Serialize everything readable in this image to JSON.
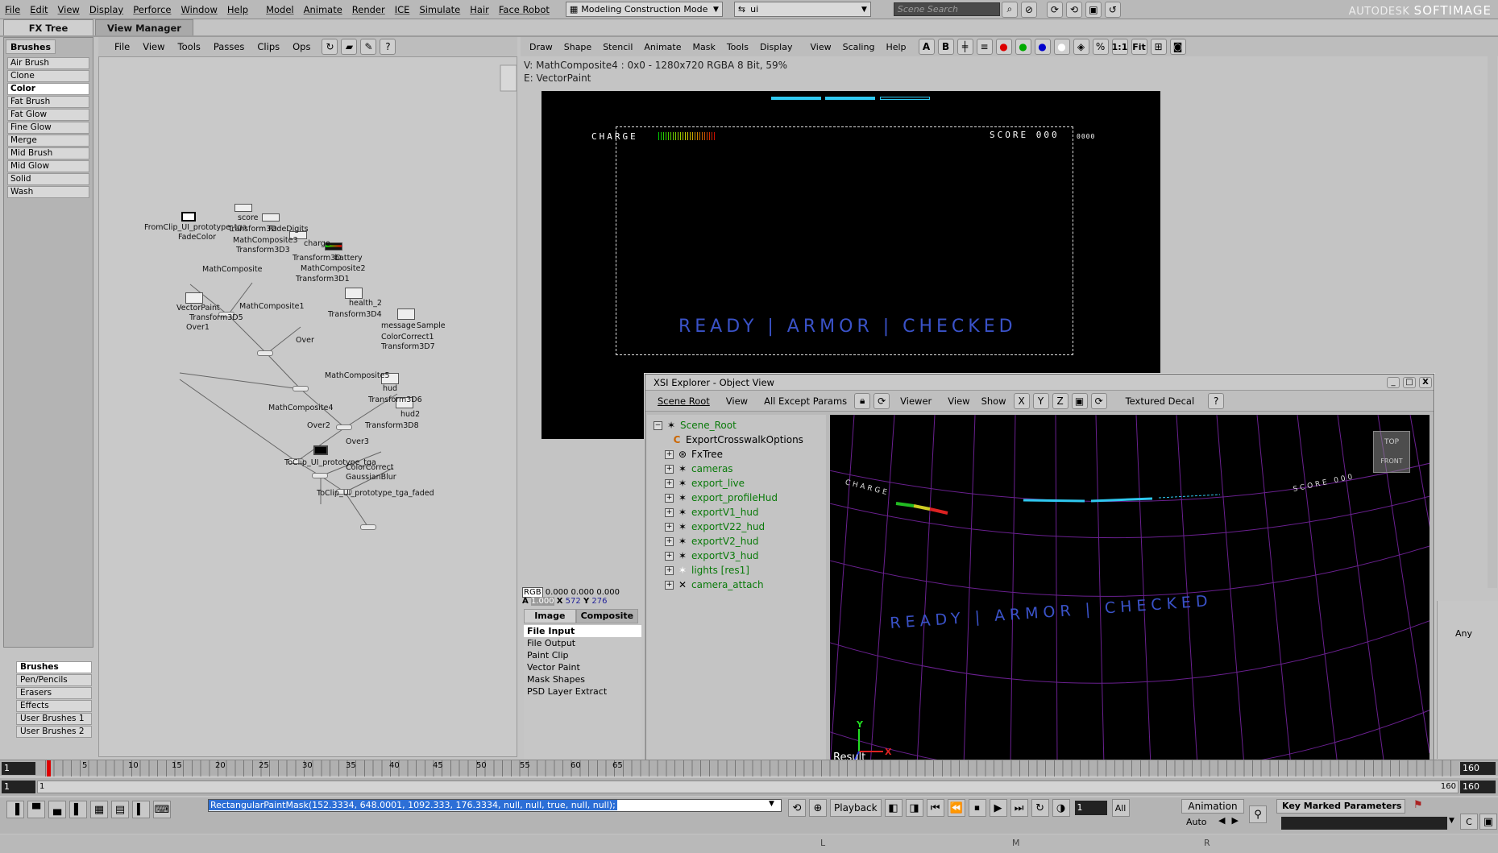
{
  "menu": {
    "items": [
      "File",
      "Edit",
      "View",
      "Display",
      "Perforce",
      "Window",
      "Help",
      "Model",
      "Animate",
      "Render",
      "ICE",
      "Simulate",
      "Hair",
      "Face Robot"
    ],
    "mode": "Modeling Construction Mode",
    "layer": "ui",
    "search_placeholder": "Scene Search",
    "brand_a": "AUTODESK",
    "brand_b": "SOFTIMAGE"
  },
  "tabs": {
    "fx_tree": "FX Tree",
    "view_manager": "View Manager"
  },
  "brushes": {
    "header": "Brushes",
    "items": [
      "Air Brush",
      "Clone",
      "Color",
      "Fat Brush",
      "Fat Glow",
      "Fine Glow",
      "Merge",
      "Mid Brush",
      "Mid Glow",
      "Solid",
      "Wash"
    ],
    "selected": "Color",
    "categories": [
      "Brushes",
      "Pen/Pencils",
      "Erasers",
      "Effects",
      "User Brushes 1",
      "User Brushes 2"
    ]
  },
  "fx_toolbar": [
    "File",
    "View",
    "Tools",
    "Passes",
    "Clips",
    "Ops"
  ],
  "fx_nodes": {
    "n1": "FromClip_UI_prototype_tga",
    "n2": "FadeColor",
    "n3": "score",
    "n4": "Transform3D",
    "n5": "FadeDigits",
    "n6": "MathComposite3",
    "n7": "Transform3D3",
    "n8": "charge",
    "n9": "battery",
    "n10": "Transform3D",
    "n11": "MathComposite2",
    "n12": "MathComposite",
    "n13": "Transform3D1",
    "n14": "health_2",
    "n15": "MathComposite1",
    "n16": "VectorPaint",
    "n17": "Transform3D4",
    "n18": "Transform3D5",
    "n19": "Over1",
    "n20": "message",
    "n21": "Sample",
    "n22": "Over",
    "n23": "ColorCorrect1",
    "n24": "Transform3D7",
    "n25": "MathComposite5",
    "n26": "hud",
    "n27": "Transform3D6",
    "n28": "MathComposite4",
    "n29": "hud2",
    "n30": "Over2",
    "n31": "Transform3D8",
    "n32": "Over3",
    "n33": "ToClip_UI_prototype_tga",
    "n34": "ColorCorrect",
    "n35": "GaussianBlur",
    "n36": "ToClip_UI_prototype_tga_faded"
  },
  "viewer_menu": [
    "Draw",
    "Shape",
    "Stencil",
    "Animate",
    "Mask",
    "Tools",
    "Display",
    "View",
    "Scaling",
    "Help"
  ],
  "viewer_toolbar": {
    "a": "A",
    "b": "B",
    "one_to_one": "1:1",
    "fit": "Fit"
  },
  "viewer_info": {
    "line1": "V: MathComposite4 : 0x0 - 1280x720 RGBA 8 Bit, 59%",
    "line2": "E: VectorPaint"
  },
  "hud": {
    "charge": "CHARGE",
    "score": "SCORE  000",
    "score_small": "0000",
    "ready": "READY | ARMOR | CHECKED"
  },
  "pixel_readout": {
    "rgb_label": "RGB",
    "rgb": "0.000  0.000  0.000",
    "a_label": "A",
    "a": "1.000",
    "x_label": "X",
    "x": "572",
    "y_label": "Y",
    "y": "276"
  },
  "image_tabs": {
    "image": "Image",
    "composite": "Composite"
  },
  "image_ops": [
    "File Input",
    "File Output",
    "Paint Clip",
    "Vector Paint",
    "Mask Shapes",
    "PSD Layer Extract"
  ],
  "explorer": {
    "title": "XSI Explorer - Object View",
    "toolbar": [
      "Scene Root",
      "View",
      "All Except Params",
      "Viewer",
      "View",
      "Show",
      "X",
      "Y",
      "Z",
      "Textured Decal",
      "?"
    ],
    "tree": [
      {
        "label": "Scene_Root",
        "color": "#0a7a0a"
      },
      {
        "label": "ExportCrosswalkOptions",
        "color": "#000"
      },
      {
        "label": "FxTree",
        "color": "#000"
      },
      {
        "label": "cameras",
        "color": "#0a7a0a"
      },
      {
        "label": "export_live",
        "color": "#0a7a0a"
      },
      {
        "label": "export_profileHud",
        "color": "#0a7a0a"
      },
      {
        "label": "exportV1_hud",
        "color": "#0a7a0a"
      },
      {
        "label": "exportV22_hud",
        "color": "#0a7a0a"
      },
      {
        "label": "exportV2_hud",
        "color": "#0a7a0a"
      },
      {
        "label": "exportV3_hud",
        "color": "#0a7a0a"
      },
      {
        "label": "lights  [res1]",
        "color": "#0a7a0a"
      },
      {
        "label": "camera_attach",
        "color": "#0a7a0a"
      }
    ],
    "viewport": {
      "charge": "CHARGE",
      "score": "SCORE  000",
      "ready": "READY  |  ARMOR  |  CHECKED",
      "cube_top": "TOP",
      "cube_front": "FRONT",
      "result": "Result",
      "axis_y": "Y",
      "axis_x": "X"
    }
  },
  "right_panel": {
    "any": "Any"
  },
  "timeline": {
    "start": "1",
    "start2": "1",
    "end": "160",
    "end2": "160",
    "end_field2": "160",
    "ticks": [
      "5",
      "10",
      "15",
      "20",
      "25",
      "30",
      "35",
      "40",
      "45",
      "50",
      "55",
      "60",
      "65"
    ]
  },
  "command": {
    "text": "RectangularPaintMask(152.3334, 648.0001, 1092.333, 176.3334, null, null, true, null, null);"
  },
  "playback": {
    "label": "Playback",
    "frame": "1",
    "all": "All",
    "animation": "Animation",
    "auto": "Auto",
    "key_marked": "Key Marked Parameters"
  },
  "bottom": {
    "l": "L",
    "m": "M",
    "r": "R"
  },
  "colors": {
    "accent": "#3a62d8",
    "hud_blue": "#4058c8",
    "cyan": "#2fc8f0",
    "grid_purple": "#7a2aa0"
  }
}
